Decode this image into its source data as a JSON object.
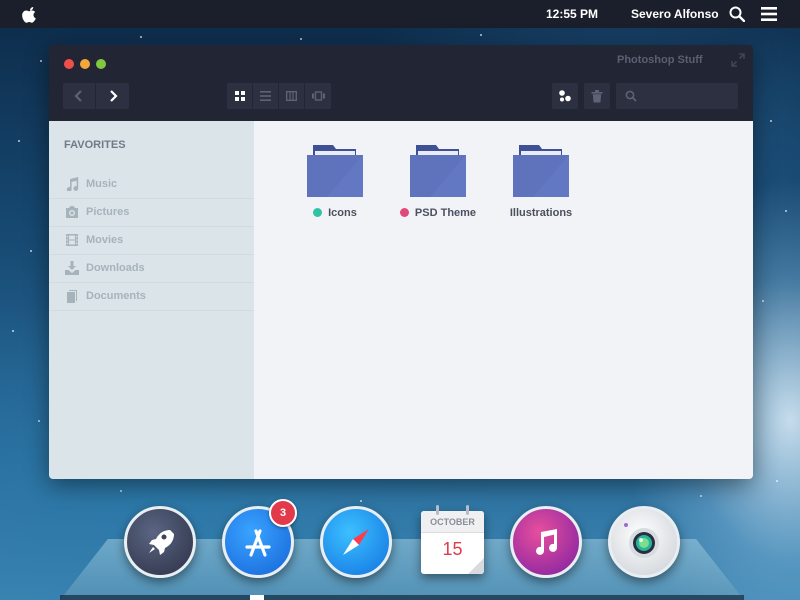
{
  "menubar": {
    "apple_icon": "apple-logo-icon",
    "time": "12:55 PM",
    "user": "Severo Alfonso",
    "search_icon": "search-icon",
    "menu_icon": "hamburger-menu-icon"
  },
  "window": {
    "title": "Photoshop Stuff",
    "controls": [
      "close",
      "minimize",
      "maximize"
    ],
    "toolbar": {
      "nav": [
        "back-arrow-icon",
        "forward-arrow-icon"
      ],
      "views": [
        "icon-view-icon",
        "list-view-icon",
        "column-view-icon",
        "cover-flow-icon"
      ],
      "actions": [
        "arrange-icon",
        "trash-icon"
      ],
      "search_placeholder": ""
    },
    "sidebar": {
      "heading": "FAVORITES",
      "items": [
        {
          "label": "Music",
          "icon": "music-note-icon"
        },
        {
          "label": "Pictures",
          "icon": "camera-icon"
        },
        {
          "label": "Movies",
          "icon": "film-icon"
        },
        {
          "label": "Downloads",
          "icon": "download-icon"
        },
        {
          "label": "Documents",
          "icon": "document-icon"
        }
      ]
    },
    "folders": [
      {
        "label": "Icons",
        "tag_color": "#2fc3a4"
      },
      {
        "label": "PSD Theme",
        "tag_color": "#e04a7a"
      },
      {
        "label": "Illustrations",
        "tag_color": ""
      }
    ]
  },
  "dock": {
    "items": [
      {
        "name": "launchpad",
        "icon": "rocket-icon"
      },
      {
        "name": "app-store",
        "icon": "app-store-icon",
        "badge": "3"
      },
      {
        "name": "safari",
        "icon": "compass-icon"
      },
      {
        "name": "calendar",
        "icon": "calendar-icon",
        "month": "OCTOBER",
        "day": "15"
      },
      {
        "name": "itunes",
        "icon": "music-note-icon"
      },
      {
        "name": "camera",
        "icon": "camera-lens-icon"
      }
    ]
  },
  "colors": {
    "folder": "#5f73bd",
    "folder_tab": "#3f5196",
    "accent_red": "#e23a4b",
    "sidebar_bg": "#dbe4e8",
    "titlebar_bg": "#222533"
  }
}
